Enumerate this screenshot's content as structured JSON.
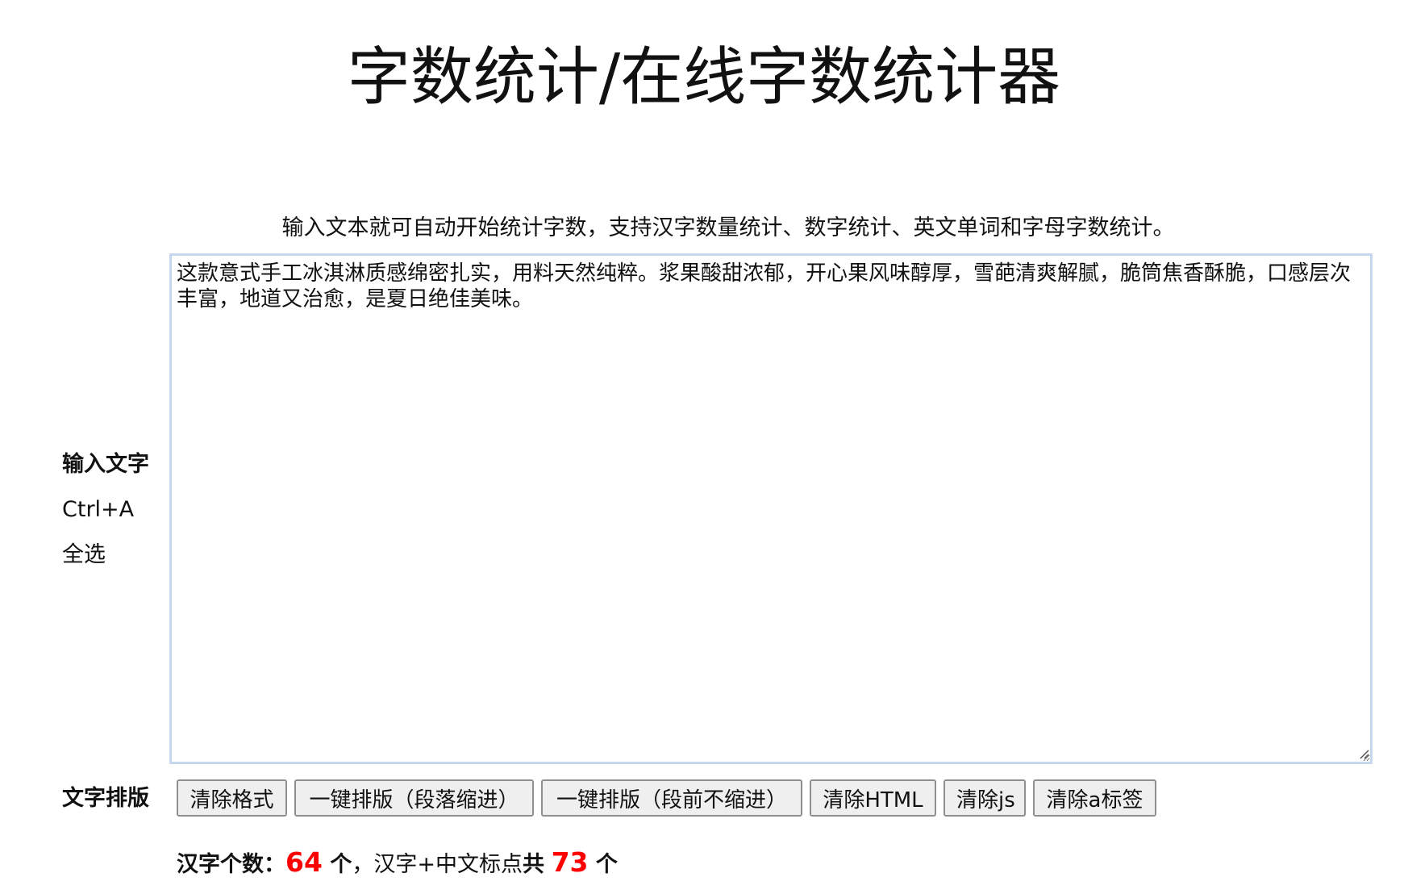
{
  "header": {
    "title": "字数统计/在线字数统计器"
  },
  "intro": {
    "text": "输入文本就可自动开始统计字数，支持汉字数量统计、数字统计、英文单词和字母字数统计。"
  },
  "input_section": {
    "label": "输入文字",
    "hint_shortcut": "Ctrl+A",
    "hint_action": "全选",
    "textarea_value": "这款意式手工冰淇淋质感绵密扎实，用料天然纯粹。浆果酸甜浓郁，开心果风味醇厚，雪葩清爽解腻，脆筒焦香酥脆，口感层次丰富，地道又治愈，是夏日绝佳美味。"
  },
  "format_section": {
    "label": "文字排版",
    "buttons": [
      {
        "label": "清除格式"
      },
      {
        "label": "一键排版（段落缩进）"
      },
      {
        "label": "一键排版（段前不缩进）"
      },
      {
        "label": "清除HTML"
      },
      {
        "label": "清除js"
      },
      {
        "label": "清除a标签"
      }
    ]
  },
  "stats": {
    "hanzi_label": "汉字个数：",
    "hanzi_count": "64",
    "unit_1": " 个",
    "separator": "，汉字+中文标点",
    "total_label": "共",
    "total_count": "73",
    "unit_2": " 个"
  }
}
